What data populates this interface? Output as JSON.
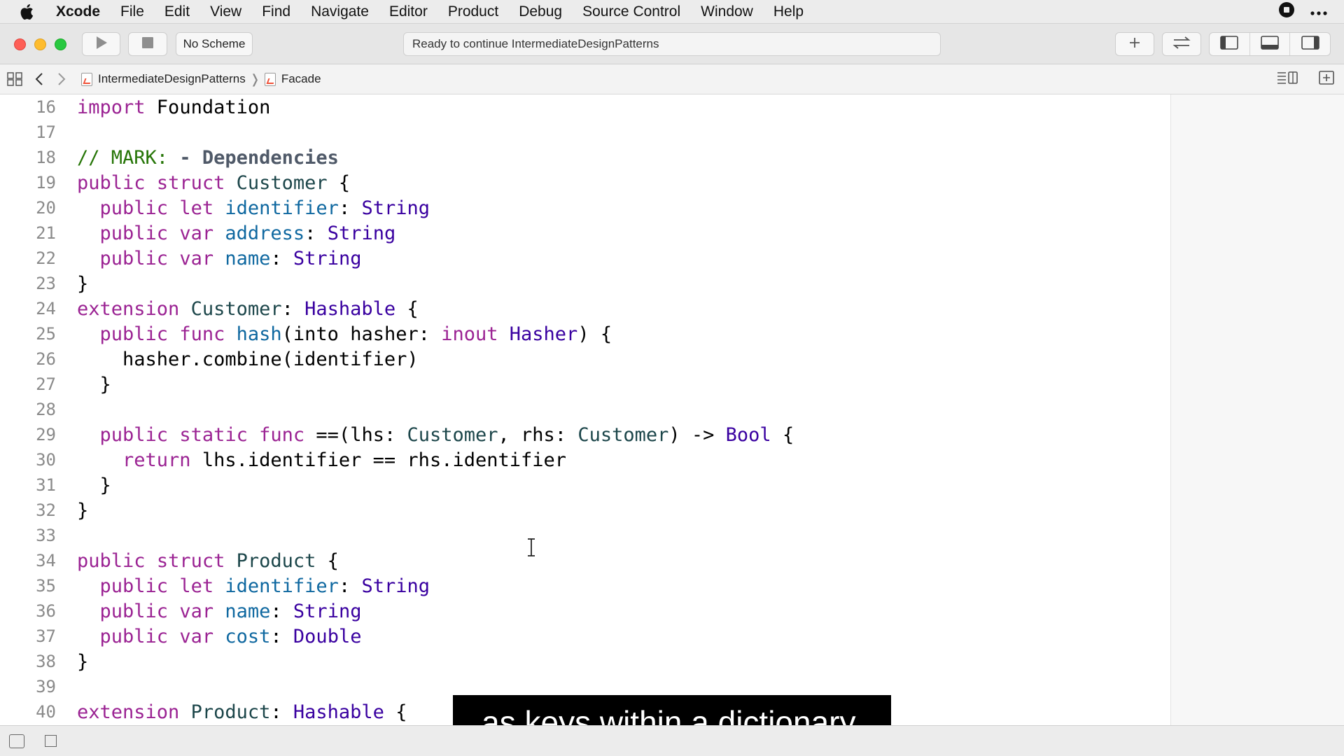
{
  "menubar": {
    "items": [
      "Xcode",
      "File",
      "Edit",
      "View",
      "Find",
      "Navigate",
      "Editor",
      "Product",
      "Debug",
      "Source Control",
      "Window",
      "Help"
    ]
  },
  "toolbar": {
    "scheme": "No Scheme",
    "status": "Ready to continue IntermediateDesignPatterns"
  },
  "jumpbar": {
    "crumbs": [
      "IntermediateDesignPatterns",
      "Facade"
    ]
  },
  "editor": {
    "lines": [
      {
        "n": "16",
        "html": "<span class=\"kw\">import</span> Foundation"
      },
      {
        "n": "17",
        "html": ""
      },
      {
        "n": "18",
        "html": "<span class=\"cm\">// MARK: </span><span class=\"cm-b\">- Dependencies</span>"
      },
      {
        "n": "19",
        "html": "<span class=\"kw\">public</span> <span class=\"kw\">struct</span> <span class=\"tyu\">Customer</span> {"
      },
      {
        "n": "20",
        "html": "  <span class=\"kw\">public</span> <span class=\"kw\">let</span> <span class=\"prop\">identifier</span>: <span class=\"ty\">String</span>"
      },
      {
        "n": "21",
        "html": "  <span class=\"kw\">public</span> <span class=\"kw\">var</span> <span class=\"prop\">address</span>: <span class=\"ty\">String</span>"
      },
      {
        "n": "22",
        "html": "  <span class=\"kw\">public</span> <span class=\"kw\">var</span> <span class=\"prop\">name</span>: <span class=\"ty\">String</span>"
      },
      {
        "n": "23",
        "html": "}"
      },
      {
        "n": "24",
        "html": "<span class=\"kw\">extension</span> <span class=\"tyu\">Customer</span>: <span class=\"ty\">Hashable</span> {"
      },
      {
        "n": "25",
        "html": "  <span class=\"kw\">public</span> <span class=\"kw\">func</span> <span class=\"prop\">hash</span>(into hasher: <span class=\"kw\">inout</span> <span class=\"ty\">Hasher</span>) {"
      },
      {
        "n": "26",
        "html": "    hasher.combine(identifier)"
      },
      {
        "n": "27",
        "html": "  }"
      },
      {
        "n": "28",
        "html": ""
      },
      {
        "n": "29",
        "html": "  <span class=\"kw\">public</span> <span class=\"kw\">static</span> <span class=\"kw\">func</span> ==(lhs: <span class=\"tyu\">Customer</span>, rhs: <span class=\"tyu\">Customer</span>) -&gt; <span class=\"ty\">Bool</span> {"
      },
      {
        "n": "30",
        "html": "    <span class=\"kw\">return</span> lhs.identifier == rhs.identifier"
      },
      {
        "n": "31",
        "html": "  }"
      },
      {
        "n": "32",
        "html": "}"
      },
      {
        "n": "33",
        "html": ""
      },
      {
        "n": "34",
        "html": "<span class=\"kw\">public</span> <span class=\"kw\">struct</span> <span class=\"tyu\">Product</span> {"
      },
      {
        "n": "35",
        "html": "  <span class=\"kw\">public</span> <span class=\"kw\">let</span> <span class=\"prop\">identifier</span>: <span class=\"ty\">String</span>"
      },
      {
        "n": "36",
        "html": "  <span class=\"kw\">public</span> <span class=\"kw\">var</span> <span class=\"prop\">name</span>: <span class=\"ty\">String</span>"
      },
      {
        "n": "37",
        "html": "  <span class=\"kw\">public</span> <span class=\"kw\">var</span> <span class=\"prop\">cost</span>: <span class=\"ty\">Double</span>"
      },
      {
        "n": "38",
        "html": "}"
      },
      {
        "n": "39",
        "html": ""
      },
      {
        "n": "40",
        "html": "<span class=\"kw\">extension</span> <span class=\"tyu\">Product</span>: <span class=\"ty\">Hashable</span> {"
      }
    ]
  },
  "caption": {
    "text": "as keys within a dictionary."
  },
  "colors": {
    "keyword": "#9b2393",
    "type": "#3900a0",
    "user_type": "#1c464a",
    "property": "#0f68a0",
    "comment": "#267507"
  }
}
